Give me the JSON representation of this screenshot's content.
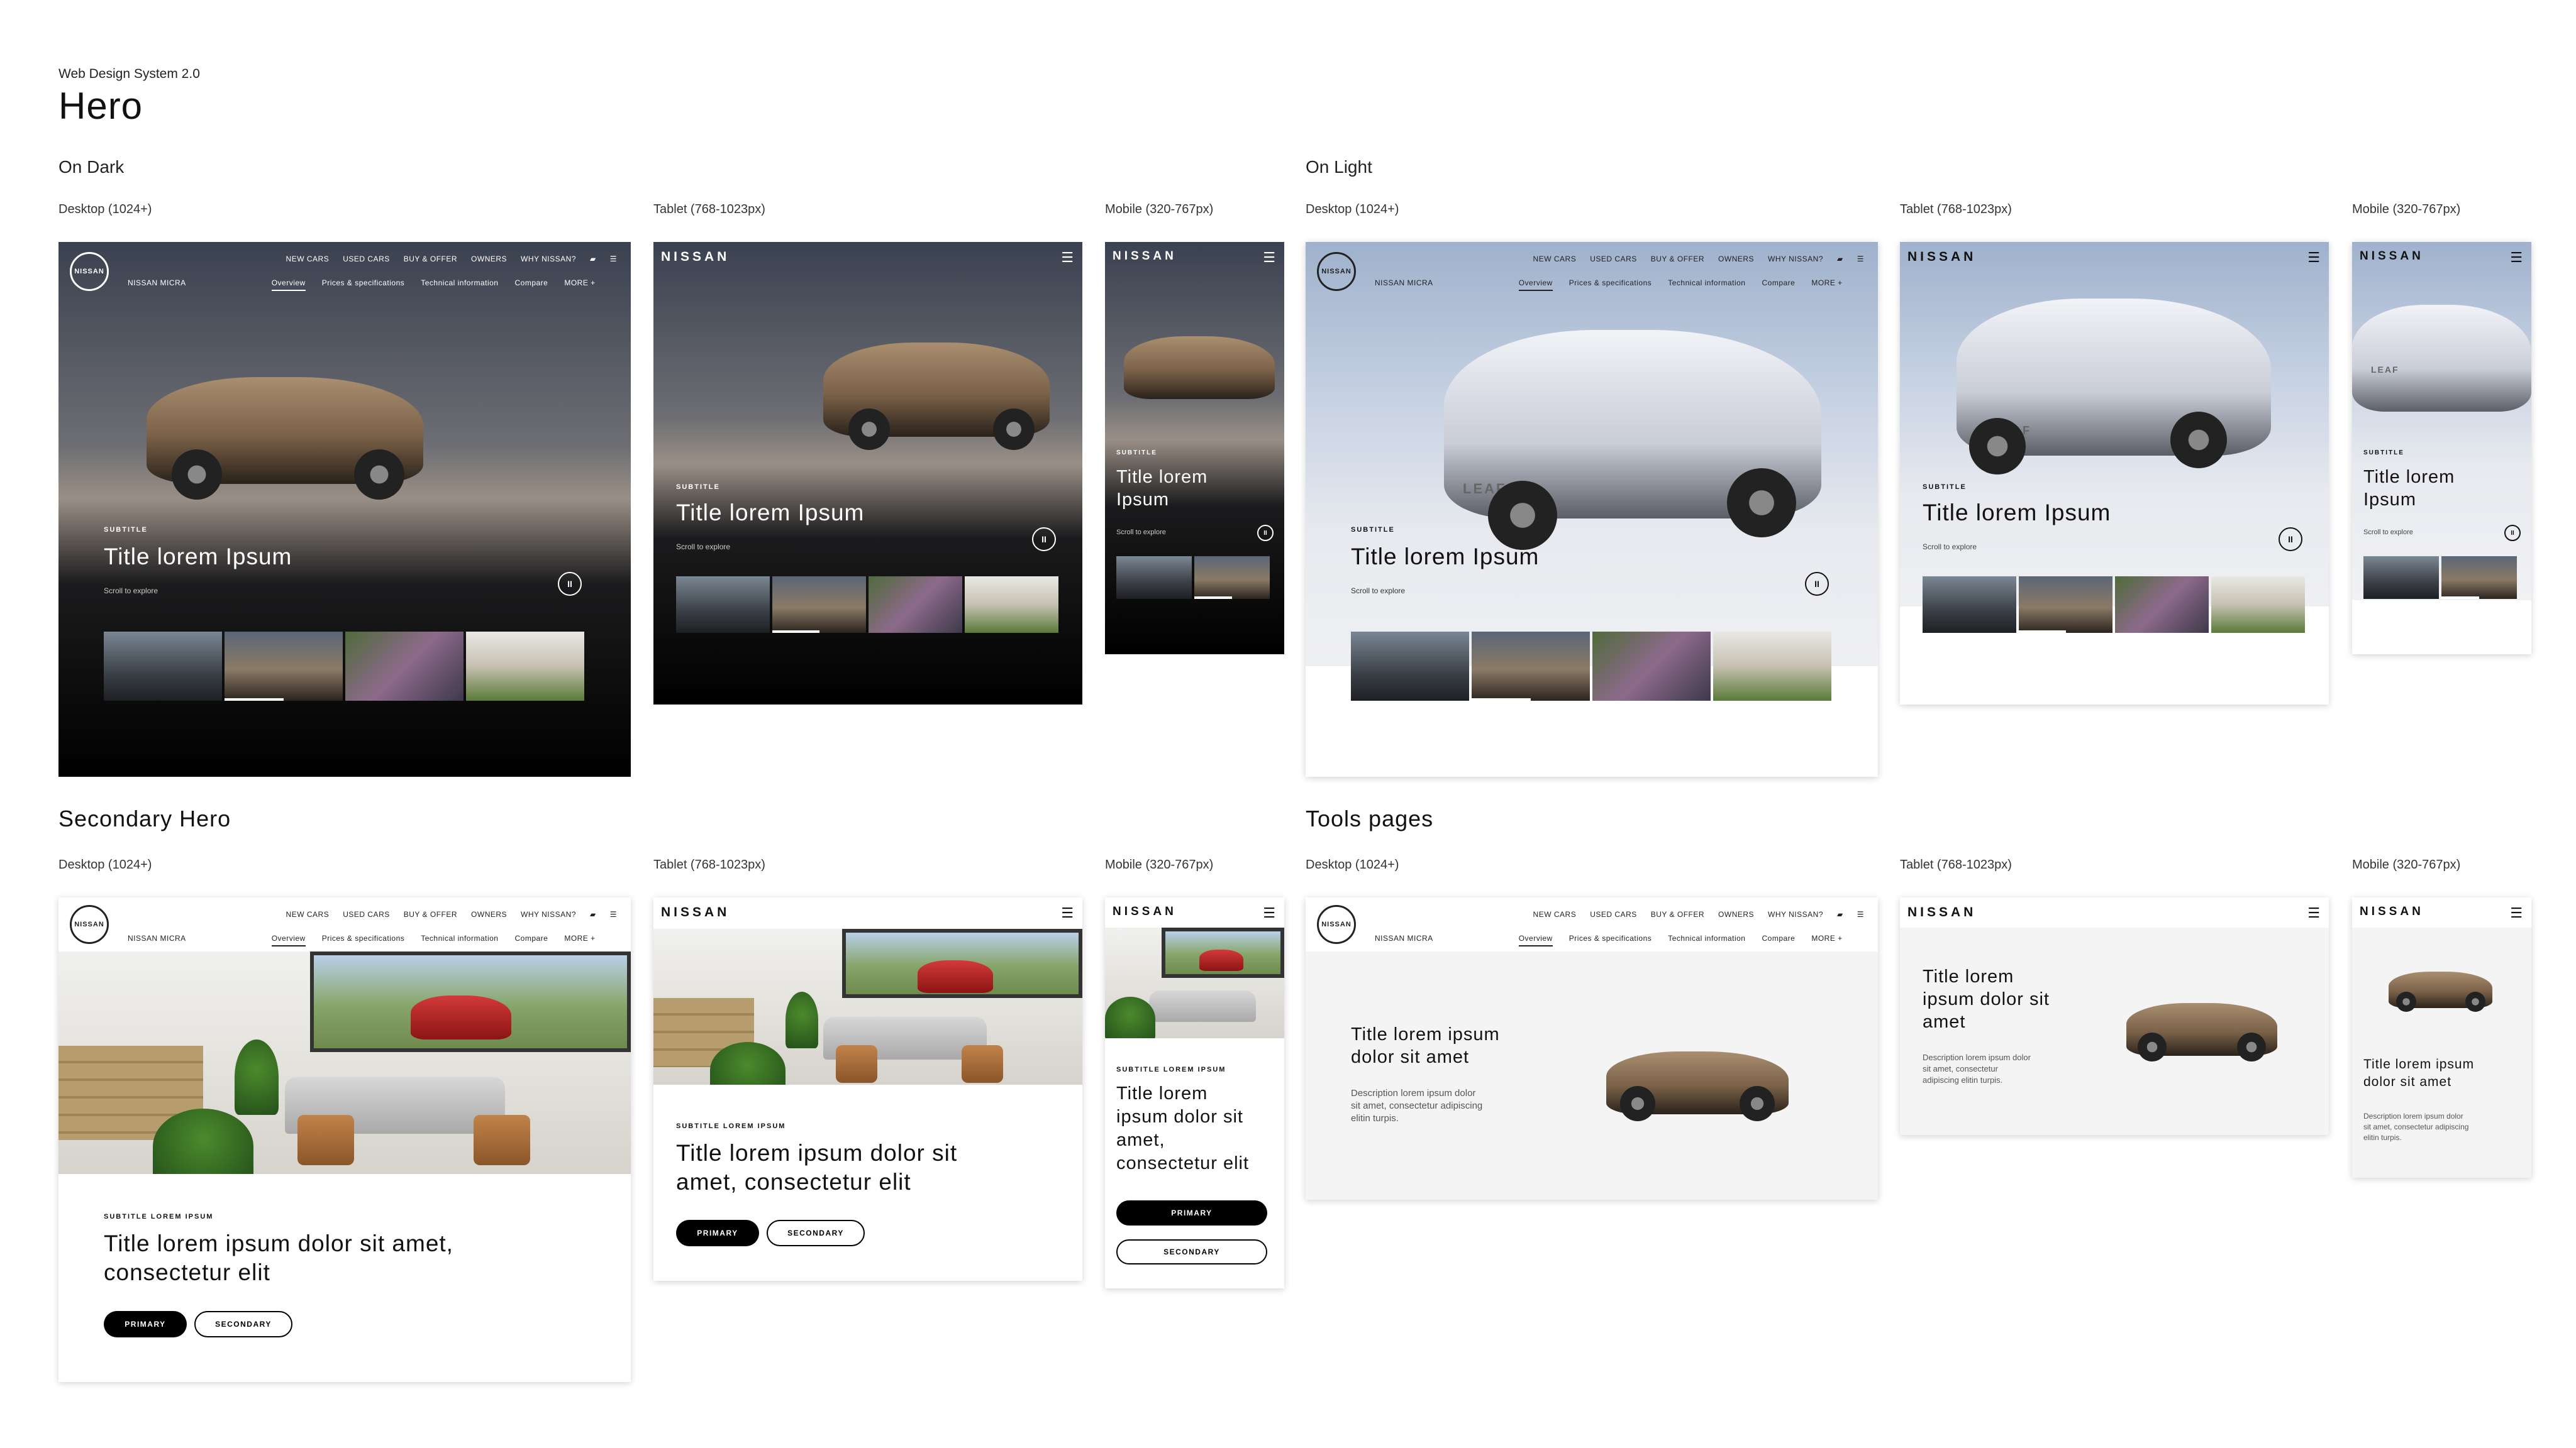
{
  "page": {
    "system_label": "Web Design System 2.0",
    "title": "Hero",
    "on_dark": "On Dark",
    "on_light": "On Light",
    "secondary_hero": "Secondary Hero",
    "tools_pages": "Tools pages"
  },
  "columns": {
    "desktop": "Desktop (1024+)",
    "tablet": "Tablet (768-1023px)",
    "mobile": "Mobile (320-767px)"
  },
  "nav": {
    "logo": "NISSAN",
    "brand": "NISSAN",
    "menu": [
      "NEW CARS",
      "USED CARS",
      "BUY & OFFER",
      "OWNERS",
      "WHY NISSAN?"
    ],
    "model": "NISSAN MICRA",
    "sub": [
      "Overview",
      "Prices & specifications",
      "Technical information",
      "Compare",
      "MORE +"
    ],
    "burger_icon": "☰",
    "chat_icon": "▰"
  },
  "hero": {
    "subtitle": "SUBTITLE",
    "title": "Title lorem Ipsum",
    "scroll": "Scroll to explore",
    "pause_icon": "II"
  },
  "secondary": {
    "subtitle": "SUBTITLE LOREM IPSUM",
    "title_desktop": "Title lorem ipsum dolor sit amet,",
    "title_desktop_2": "consectetur elit",
    "title_tablet": "Title lorem ipsum dolor sit",
    "title_tablet_2": "amet, consectetur elit",
    "title_mobile": [
      "Title lorem",
      "ipsum dolor sit",
      "amet,",
      "consectetur elit"
    ],
    "primary": "PRIMARY",
    "secondary": "SECONDARY"
  },
  "tools": {
    "title_desktop": [
      "Title lorem ipsum",
      "dolor sit amet"
    ],
    "desc_desktop": [
      "Description lorem ipsum dolor",
      "sit amet, consectetur adipiscing",
      "elitin turpis."
    ],
    "title_tablet": [
      "Title lorem",
      "ipsum dolor sit",
      "amet"
    ],
    "desc_tablet": [
      "Description lorem ipsum dolor",
      "sit amet, consectetur",
      "adipiscing elitin turpis."
    ],
    "title_mobile": [
      "Title lorem ipsum",
      "dolor sit amet"
    ],
    "desc_mobile": [
      "Description lorem ipsum dolor",
      "sit amet, consectetur adipiscing",
      "elitin turpis."
    ]
  },
  "car_badge": "LEAF"
}
